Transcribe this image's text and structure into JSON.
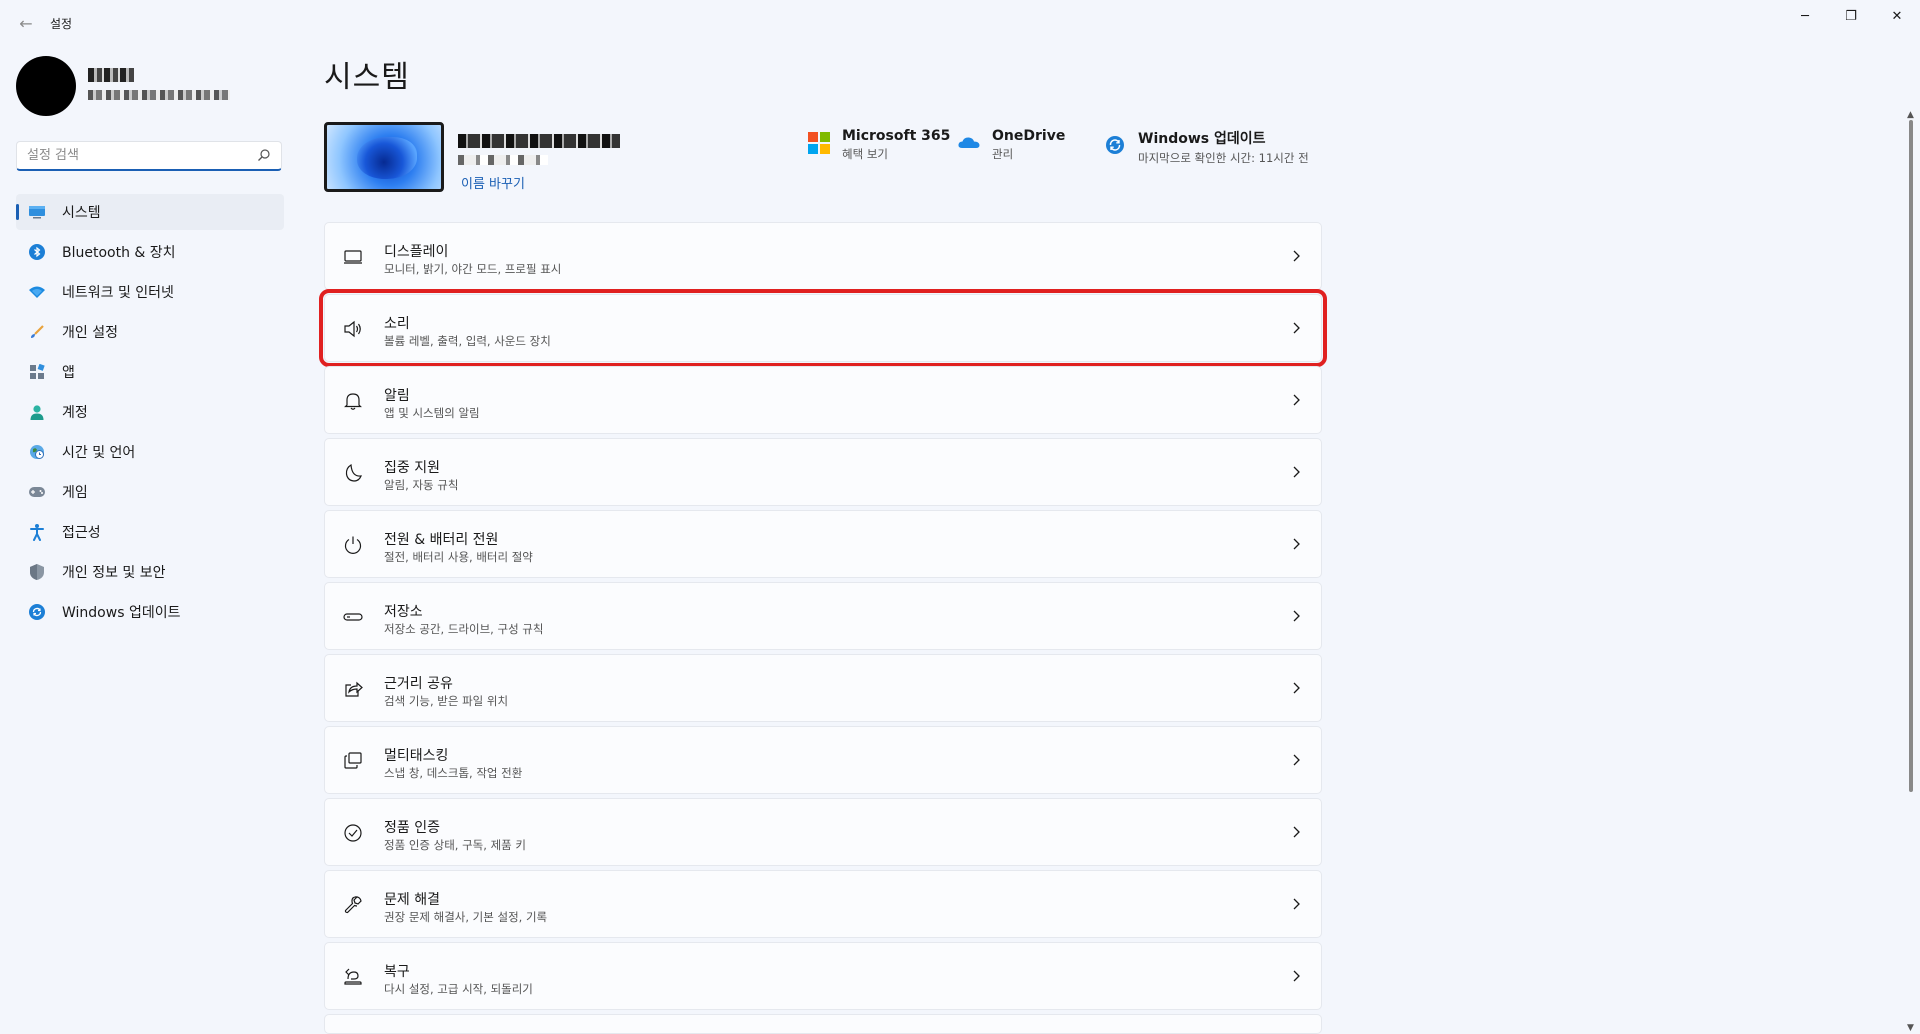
{
  "window": {
    "title": "설정",
    "back_glyph": "←",
    "minimize_glyph": "─",
    "maximize_glyph": "❐",
    "close_glyph": "✕"
  },
  "sidebar": {
    "search_placeholder": "설정 검색",
    "items": [
      {
        "label": "시스템",
        "icon": "monitor-icon",
        "active": true
      },
      {
        "label": "Bluetooth & 장치",
        "icon": "bluetooth-icon"
      },
      {
        "label": "네트워크 및 인터넷",
        "icon": "wifi-icon"
      },
      {
        "label": "개인 설정",
        "icon": "brush-icon"
      },
      {
        "label": "앱",
        "icon": "apps-icon"
      },
      {
        "label": "계정",
        "icon": "account-icon"
      },
      {
        "label": "시간 및 언어",
        "icon": "globe-clock-icon"
      },
      {
        "label": "게임",
        "icon": "gamepad-icon"
      },
      {
        "label": "접근성",
        "icon": "accessibility-icon"
      },
      {
        "label": "개인 정보 및 보안",
        "icon": "shield-icon"
      },
      {
        "label": "Windows 업데이트",
        "icon": "update-icon"
      }
    ]
  },
  "main": {
    "title": "시스템",
    "device": {
      "rename_label": "이름 바꾸기"
    },
    "quick_links": {
      "m365": {
        "title": "Microsoft 365",
        "subtitle": "혜택 보기"
      },
      "onedrive": {
        "title": "OneDrive",
        "subtitle": "관리"
      },
      "winupdate": {
        "title": "Windows 업데이트",
        "subtitle": "마지막으로 확인한 시간: 11시간 전"
      }
    },
    "cards": [
      {
        "title": "디스플레이",
        "subtitle": "모니터, 밝기, 야간 모드, 프로필 표시",
        "icon": "display-icon"
      },
      {
        "title": "소리",
        "subtitle": "볼륨 레벨, 출력, 입력, 사운드 장치",
        "icon": "speaker-icon",
        "highlighted": true
      },
      {
        "title": "알림",
        "subtitle": "앱 및 시스템의 알림",
        "icon": "bell-icon"
      },
      {
        "title": "집중 지원",
        "subtitle": "알림, 자동 규칙",
        "icon": "moon-icon"
      },
      {
        "title": "전원 & 배터리 전원",
        "subtitle": "절전, 배터리 사용, 배터리 절약",
        "icon": "power-icon"
      },
      {
        "title": "저장소",
        "subtitle": "저장소 공간, 드라이브, 구성 규칙",
        "icon": "storage-icon"
      },
      {
        "title": "근거리 공유",
        "subtitle": "검색 기능, 받은 파일 위치",
        "icon": "share-icon"
      },
      {
        "title": "멀티태스킹",
        "subtitle": "스냅 창, 데스크톱, 작업 전환",
        "icon": "multitask-icon"
      },
      {
        "title": "정품 인증",
        "subtitle": "정품 인증 상태, 구독, 제품 키",
        "icon": "check-circle-icon"
      },
      {
        "title": "문제 해결",
        "subtitle": "권장 문제 해결사, 기본 설정, 기록",
        "icon": "wrench-icon"
      },
      {
        "title": "복구",
        "subtitle": "다시 설정, 고급 시작, 되돌리기",
        "icon": "recovery-icon"
      }
    ]
  },
  "colors": {
    "accent": "#1a5fb4",
    "background": "#f3f6fc",
    "highlight_border": "#e02020"
  }
}
